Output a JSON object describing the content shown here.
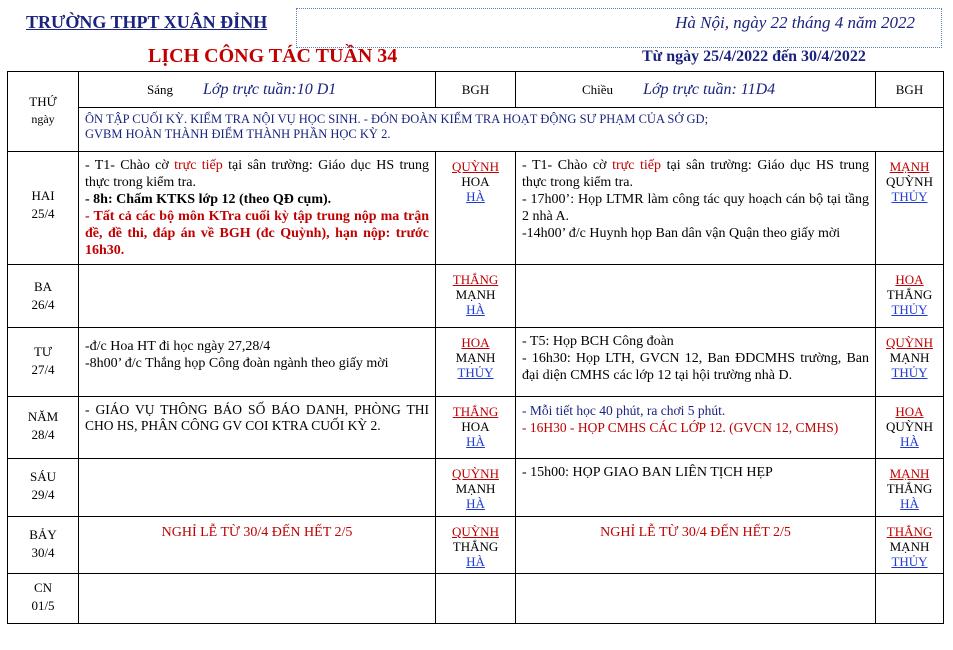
{
  "header": {
    "school": "TRƯỜNG THPT XUÂN ĐỈNH",
    "date": "Hà Nội, ngày 22  tháng  4  năm 2022",
    "title": "LỊCH CÔNG TÁC TUẦN 34",
    "range": "Từ ngày 25/4/2022 đến 30/4/2022"
  },
  "table": {
    "col_day": "THỨ",
    "col_day_sub": "ngày",
    "col_morning": "Sáng",
    "morning_duty": "Lớp trực tuần:10 D1",
    "col_bgh1": "BGH",
    "col_afternoon": "Chiều",
    "afternoon_duty": "Lớp trực tuần:  11D4",
    "col_bgh2": "BGH",
    "note_line1": "ÔN TẬP CUỐI KỲ. KIỂM TRA NỘI VỤ HỌC SINH.  - ĐÓN ĐOÀN KIỂM TRA HOẠT ĐỘNG SƯ PHẠM CỦA SỞ GD;",
    "note_line2": "GVBM HOÀN THÀNH ĐIỂM THÀNH PHẦN HỌC KỲ 2."
  },
  "days": [
    {
      "name": "HAI",
      "date": "25/4",
      "morning": {
        "a1": "- T1- Chào cờ ",
        "a_red": "trực tiếp",
        "a2": " tại sân trường: Giáo dục HS trung thực trong kiểm tra.",
        "b": "- 8h: Chấm KTKS lớp 12 (theo QĐ cụm).",
        "c": "- Tất cả các bộ môn KTra cuối kỳ tập trung nộp ma trận đề, đề thi, đáp án về BGH (đc Quỳnh), hạn nộp: trước 16h30."
      },
      "bgh1": [
        "QUỲNH",
        "HOA",
        "HÀ"
      ],
      "afternoon": {
        "a1": "- T1- Chào cờ ",
        "a_red": "trực tiếp",
        "a2": " tại sân trường: Giáo dục HS trung thực trong kiểm tra.",
        "b": "- 17h00’: Họp LTMR làm công tác quy hoạch cán bộ tại tầng 2 nhà A.",
        "c": "-14h00’ đ/c Huynh họp Ban dân vận Quận theo giấy mời"
      },
      "bgh2": [
        "MẠNH",
        "QUỲNH",
        "THỦY"
      ]
    },
    {
      "name": "BA",
      "date": "26/4",
      "bgh1": [
        "THẮNG",
        "MẠNH",
        "HÀ"
      ],
      "bgh2": [
        "HOA",
        "THẮNG",
        "THỦY"
      ]
    },
    {
      "name": "TƯ",
      "date": "27/4",
      "morning": {
        "a": "-đ/c Hoa HT đi học ngày 27,28/4",
        "b": "-8h00’ đ/c Thắng họp Công đoàn ngành theo giấy mời"
      },
      "bgh1": [
        "HOA",
        "MẠNH",
        "THỦY"
      ],
      "afternoon": {
        "a": "- T5: Họp BCH Công đoàn",
        "b": "- 16h30: Họp LTH, GVCN 12, Ban ĐDCMHS trường, Ban đại diện CMHS các lớp 12 tại hội trường nhà D."
      },
      "bgh2": [
        "QUỲNH",
        "MẠNH",
        "THỦY"
      ]
    },
    {
      "name": "NĂM",
      "date": "28/4",
      "morning": {
        "a": "- GIÁO VỤ THÔNG BÁO SỐ BÁO DANH, PHÒNG THI CHO HS, PHÂN CÔNG GV COI KTRA CUỐI KỲ 2."
      },
      "bgh1": [
        "THẮNG",
        "HOA",
        "HÀ"
      ],
      "afternoon": {
        "a": "- Mỗi tiết học 40 phút, ra chơi 5 phút.",
        "b": "- 16H30 - HỌP CMHS CÁC LỚP 12. (GVCN 12, CMHS)"
      },
      "bgh2": [
        "HOA",
        "QUỲNH",
        "HÀ"
      ]
    },
    {
      "name": "SÁU",
      "date": "29/4",
      "bgh1": [
        "QUỲNH",
        "MẠNH",
        "HÀ"
      ],
      "afternoon": {
        "a": "- 15h00: HỌP GIAO BAN LIÊN TỊCH HẸP"
      },
      "bgh2": [
        "MẠNH",
        "THẮNG",
        "HÀ"
      ]
    },
    {
      "name": "BẢY",
      "date": "30/4",
      "morning_holiday": "NGHỈ LỄ TỪ 30/4 ĐẾN HẾT 2/5",
      "bgh1": [
        "QUỲNH",
        "THẮNG",
        "HÀ"
      ],
      "afternoon_holiday": "NGHỈ LỄ TỪ 30/4 ĐẾN HẾT 2/5",
      "bgh2": [
        "THẮNG",
        "MẠNH",
        "THỦY"
      ]
    },
    {
      "name": "CN",
      "date": "01/5"
    }
  ]
}
